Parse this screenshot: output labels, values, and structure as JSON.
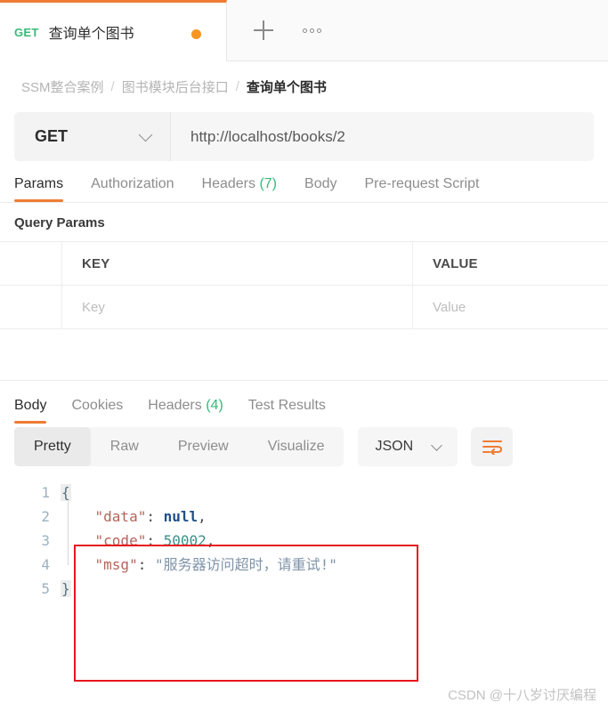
{
  "tabbar": {
    "active_tab": {
      "method": "GET",
      "title": "查询单个图书",
      "unsaved_indicator": "●"
    },
    "new_tab_label": "+",
    "more_label": "ooo"
  },
  "breadcrumb": {
    "items": [
      "SSM整合案例",
      "图书模块后台接口",
      "查询单个图书"
    ],
    "separator": "/"
  },
  "request": {
    "method": "GET",
    "url": "http://localhost/books/2",
    "tabs": [
      {
        "label": "Params",
        "active": true
      },
      {
        "label": "Authorization",
        "active": false
      },
      {
        "label": "Headers",
        "count": "(7)",
        "active": false
      },
      {
        "label": "Body",
        "active": false
      },
      {
        "label": "Pre-request Script",
        "active": false
      }
    ],
    "query_params": {
      "section_title": "Query Params",
      "columns": [
        "KEY",
        "VALUE"
      ],
      "rows": [
        {
          "key_placeholder": "Key",
          "value_placeholder": "Value"
        }
      ]
    }
  },
  "response": {
    "tabs": [
      {
        "label": "Body",
        "active": true
      },
      {
        "label": "Cookies",
        "active": false
      },
      {
        "label": "Headers",
        "count": "(4)",
        "active": false
      },
      {
        "label": "Test Results",
        "active": false
      }
    ],
    "formats": [
      {
        "label": "Pretty",
        "selected": true
      },
      {
        "label": "Raw",
        "selected": false
      },
      {
        "label": "Preview",
        "selected": false
      },
      {
        "label": "Visualize",
        "selected": false
      }
    ],
    "language": "JSON",
    "wrap_icon": "word-wrap-icon",
    "body": {
      "line_numbers": [
        "1",
        "2",
        "3",
        "4",
        "5"
      ],
      "lines": [
        {
          "open_brace": "{"
        },
        {
          "key": "\"data\"",
          "punct": ": ",
          "null_value": "null",
          "comma": ","
        },
        {
          "key": "\"code\"",
          "punct": ": ",
          "number_value": "50002",
          "comma": ","
        },
        {
          "key": "\"msg\"",
          "punct": ": ",
          "string_value": "\"服务器访问超时，请重试!\""
        },
        {
          "close_brace": "}"
        }
      ],
      "raw": "{\n    \"data\": null,\n    \"code\": 50002,\n    \"msg\": \"服务器访问超时，请重试!\"\n}"
    }
  },
  "annotation": {
    "highlight_color": "#e8161d"
  },
  "watermark": "CSDN @十八岁讨厌编程",
  "colors": {
    "accent": "#ef7c33",
    "method_get": "#3bb878",
    "count": "#3bb878"
  }
}
